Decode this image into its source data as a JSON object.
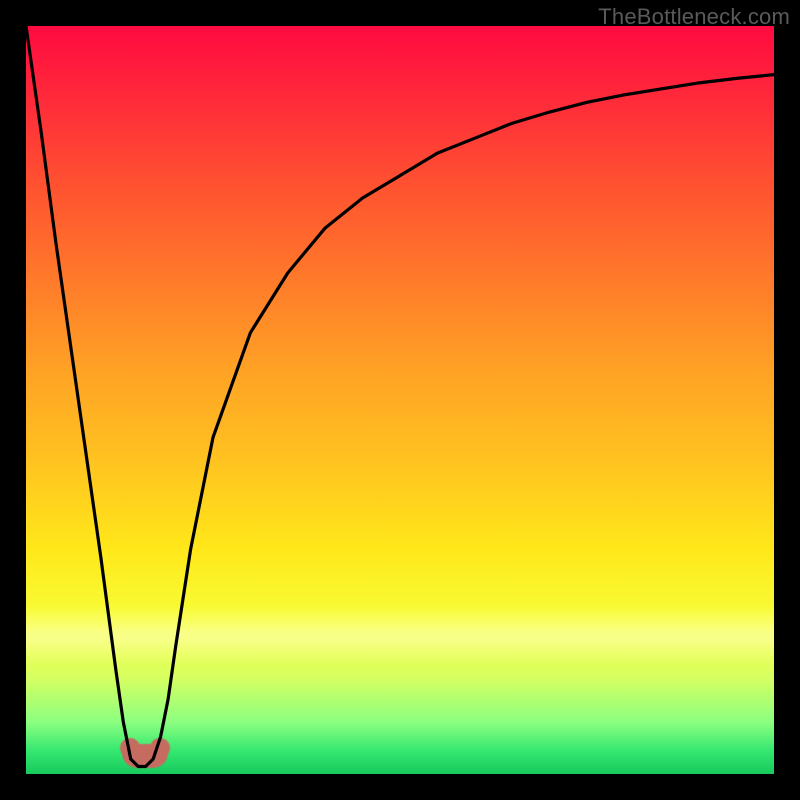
{
  "attribution": "TheBottleneck.com",
  "colors": {
    "background": "#000000",
    "curve_stroke": "#000000",
    "blob": "#c66b60",
    "gradient_stops": [
      "#ff0a40",
      "#ff2b3a",
      "#ff5430",
      "#ff7a2a",
      "#ffa225",
      "#ffc220",
      "#ffe81a",
      "#f6ff3a",
      "#d8ff60",
      "#8cff80",
      "#33e770",
      "#18c95c"
    ]
  },
  "chart_data": {
    "type": "line",
    "title": "",
    "xlabel": "",
    "ylabel": "",
    "xlim": [
      0,
      100
    ],
    "ylim": [
      0,
      100
    ],
    "x": [
      0,
      2,
      4,
      6,
      8,
      10,
      12,
      13,
      14,
      15,
      16,
      17,
      18,
      19,
      20,
      22,
      25,
      30,
      35,
      40,
      45,
      50,
      55,
      60,
      65,
      70,
      75,
      80,
      85,
      90,
      95,
      100
    ],
    "values": [
      100,
      86,
      71,
      57,
      43,
      29,
      14,
      7,
      2,
      1,
      1,
      2,
      5,
      10,
      17,
      30,
      45,
      59,
      67,
      73,
      77,
      80,
      83,
      85,
      87,
      88.5,
      89.8,
      90.8,
      91.6,
      92.4,
      93,
      93.5
    ],
    "notch_x": 16,
    "blob": {
      "x_center": 16,
      "y": 1.5,
      "width_x": 6
    }
  }
}
